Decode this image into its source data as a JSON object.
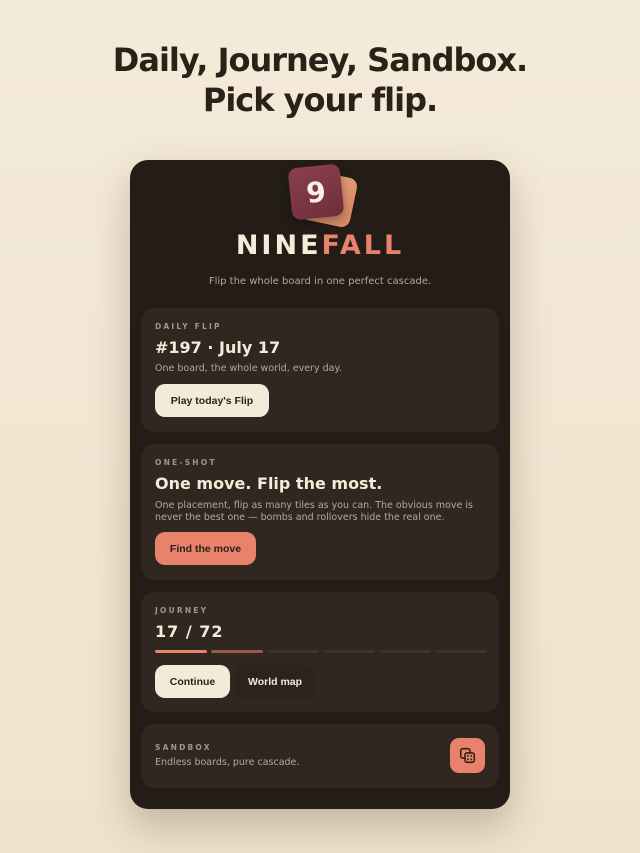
{
  "headline": {
    "line1": "Daily, Journey, Sandbox.",
    "line2": "Pick your flip."
  },
  "logo": {
    "tile_digit": "9",
    "brand_part1": "NINE",
    "brand_part2": "FALL",
    "tagline": "Flip the whole board in one perfect cascade."
  },
  "daily": {
    "label": "DAILY FLIP",
    "title": "#197 · July 17",
    "desc": "One board, the whole world, every day.",
    "button": "Play today's Flip"
  },
  "oneshot": {
    "label": "ONE-SHOT",
    "title": "One move. Flip the most.",
    "desc": "One placement, flip as many tiles as you can. The obvious move is never the best one — bombs and rollovers hide the real one.",
    "button": "Find the move"
  },
  "journey": {
    "label": "JOURNEY",
    "progress_text": "17 / 72",
    "progress": {
      "current": 17,
      "total": 72
    },
    "continue_button": "Continue",
    "worldmap_button": "World map"
  },
  "sandbox": {
    "label": "SANDBOX",
    "desc": "Endless boards, pure cascade.",
    "icon": "dice-icon"
  },
  "colors": {
    "accent": "#e8826b",
    "panel": "#241d17",
    "card": "#2f2720",
    "cream": "#f4ead9"
  }
}
